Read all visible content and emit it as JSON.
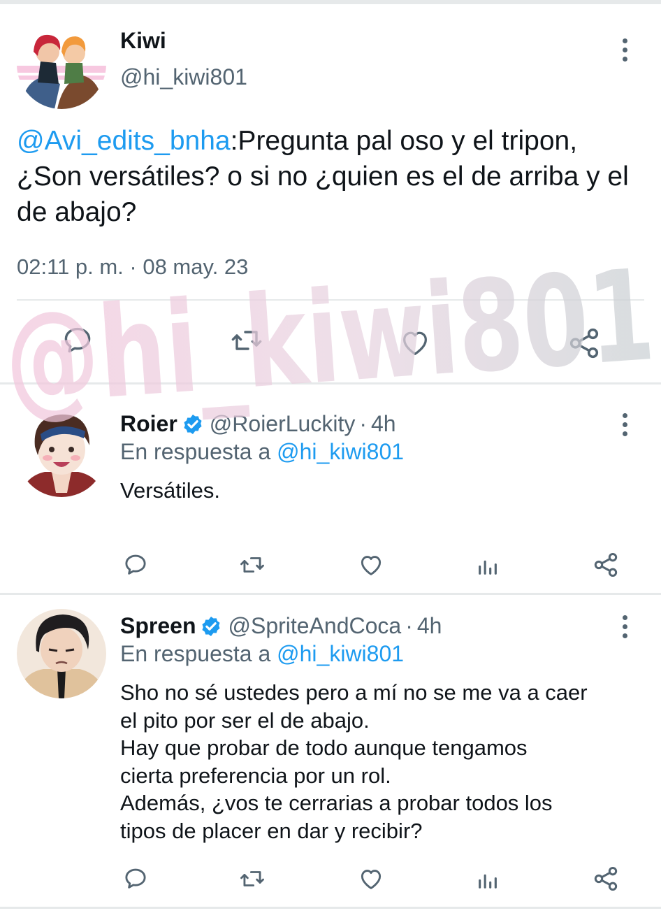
{
  "colors": {
    "text": "#0f1419",
    "secondary": "#536471",
    "link": "#1d9bf0",
    "divider": "#e6e9ea",
    "watermark_pink": "#f2c6dc",
    "watermark_gray": "#c9d0d3"
  },
  "main_tweet": {
    "author_name": "Kiwi",
    "author_handle": "@hi_kiwi801",
    "mention": "@Avi_edits_bnha",
    "text": ":Pregunta pal oso y el tripon, ¿Son versátiles? o si no ¿quien es el de arriba y el de abajo?",
    "timestamp": "02:11 p. m. · 08 may. 23",
    "actions": [
      "comment-icon",
      "retweet-icon",
      "like-icon",
      "share-icon"
    ]
  },
  "watermark": {
    "text": "@hi_kiwi801"
  },
  "replies": [
    {
      "author_name": "Roier",
      "author_handle": "@RoierLuckity",
      "separator": "·",
      "time": "4h",
      "reply_to_label": "En respuesta a",
      "reply_to_handle": "@hi_kiwi801",
      "lines": [
        "Versátiles."
      ],
      "actions": [
        "comment-icon",
        "retweet-icon",
        "like-icon",
        "stats-icon",
        "share-icon"
      ]
    },
    {
      "author_name": "Spreen",
      "author_handle": "@SpriteAndCoca",
      "separator": "·",
      "time": "4h",
      "reply_to_label": "En respuesta a",
      "reply_to_handle": "@hi_kiwi801",
      "lines": [
        "Sho no sé ustedes pero a mí no se me va a caer",
        "el pito por ser el de abajo.",
        "Hay que probar de todo aunque tengamos",
        "cierta preferencia por un rol.",
        "Además, ¿vos te cerrarias a probar todos los",
        "tipos de placer en dar y recibir?"
      ],
      "actions": [
        "comment-icon",
        "retweet-icon",
        "like-icon",
        "stats-icon",
        "share-icon"
      ]
    }
  ]
}
